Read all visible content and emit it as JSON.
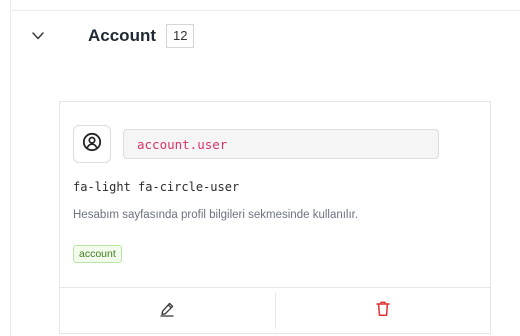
{
  "group": {
    "title": "Account",
    "count": "12",
    "expanded_icon": "chevron-down-icon"
  },
  "card": {
    "icon": "circle-user-icon",
    "key": "account.user",
    "class_name": "fa-light fa-circle-user",
    "description": "Hesabım sayfasında profil bilgileri sekmesinde kullanılır.",
    "tag": "account",
    "actions": {
      "edit_icon": "pen-icon",
      "delete_icon": "trash-icon"
    }
  },
  "colors": {
    "key_text": "#d6336c",
    "delete_icon": "#e03131",
    "tag_text": "#3f7d20",
    "tag_border": "#b9e6a3"
  }
}
